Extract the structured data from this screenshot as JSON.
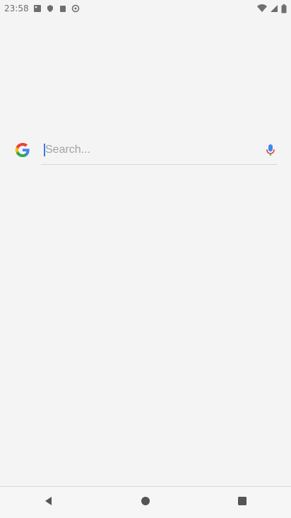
{
  "status_bar": {
    "time": "23:58",
    "left_icons": [
      "photos-icon",
      "shield-icon",
      "clipboard-icon",
      "vpn-icon"
    ],
    "right_icons": [
      "wifi-icon",
      "signal-icon",
      "battery-icon"
    ]
  },
  "search": {
    "placeholder": "Search...",
    "logo": "google-g-icon",
    "mic": "microphone-icon"
  },
  "nav": {
    "items": [
      "back-icon",
      "home-icon",
      "recents-icon"
    ]
  },
  "colors": {
    "accent": "#3b78e7",
    "background": "#f4f4f4"
  }
}
